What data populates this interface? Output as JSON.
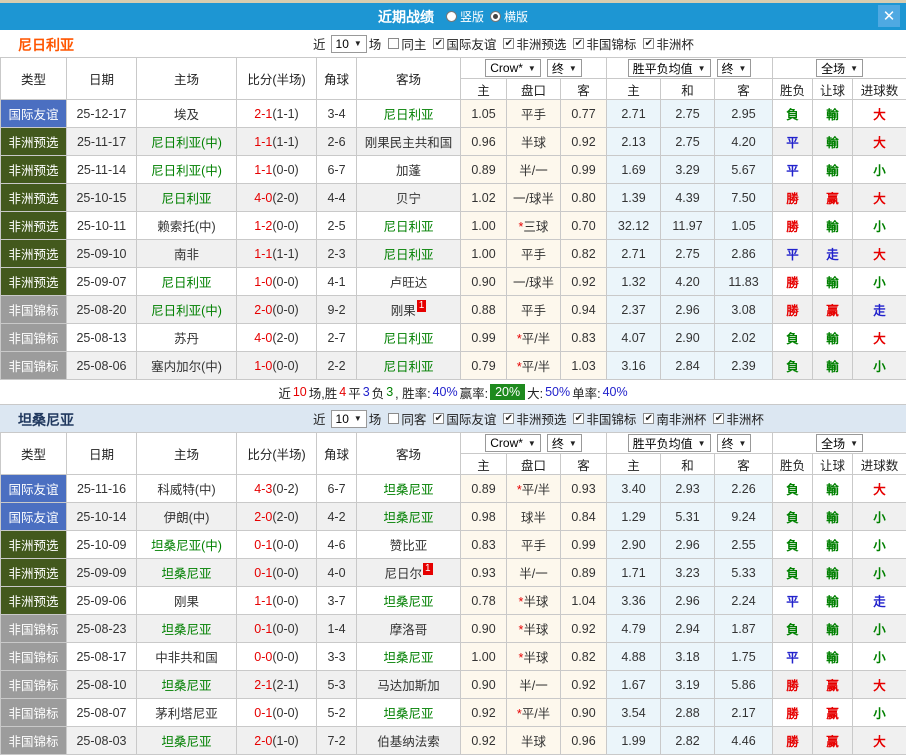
{
  "titlebar": {
    "title": "近期战绩",
    "radio_options": [
      {
        "label": "竖版",
        "selected": false
      },
      {
        "label": "横版",
        "selected": true
      }
    ],
    "close_label": "✕"
  },
  "table_header": {
    "type": "类型",
    "date": "日期",
    "home": "主场",
    "score": "比分(半场)",
    "corner": "角球",
    "away": "客场",
    "company_dd": "Crow*",
    "final_dd": "终",
    "avg_dd": "胜平负均值",
    "final_dd2": "终",
    "full_dd": "全场",
    "sub": {
      "odds_home": "主",
      "handicap": "盘口",
      "odds_away": "客",
      "avg_home": "主",
      "avg_draw": "和",
      "avg_away": "客",
      "result": "胜负",
      "handicap_result": "让球",
      "goals": "进球数"
    }
  },
  "colors": {
    "title_bar": "#1d96d3",
    "close_button": "#4fa9e2",
    "nigeria_text": "#ff5500",
    "nigeria_bar": "#ffffff",
    "tanzania_text": "#21395f",
    "tanzania_bar": "#dce7f2",
    "focal_team": "#008000",
    "win": "#e60000",
    "draw": "#2222cc",
    "lose": "#008000",
    "type_friendly": "#4b6fc1",
    "type_qualifier": "#43591d",
    "type_championship": "#9c9c9c",
    "red_card_badge": "#e60000",
    "summary_badge": "#1e8a1e"
  },
  "sections": [
    {
      "team": "尼日利亚",
      "team_color": "#ff5500",
      "bar_bg": "#ffffff",
      "filters": {
        "near_label": "近",
        "count": "10",
        "games_label": "场",
        "same_label": "同主",
        "same_checked": false,
        "leagues": [
          {
            "label": "国际友谊",
            "checked": true
          },
          {
            "label": "非洲预选",
            "checked": true
          },
          {
            "label": "非国锦标",
            "checked": true
          },
          {
            "label": "非洲杯",
            "checked": true
          }
        ]
      },
      "rows": [
        {
          "type": "国际友谊",
          "date": "25-12-17",
          "home": "埃及",
          "home_focal": false,
          "home_badge": "",
          "score_ft": "2-1",
          "score_ht": "(1-1)",
          "corners": "3-4",
          "away": "尼日利亚",
          "away_focal": true,
          "away_badge": "",
          "odds_home": "1.05",
          "handicap": "平手",
          "odds_away": "0.77",
          "avg_home": "2.71",
          "avg_draw": "2.75",
          "avg_away": "2.95",
          "result": "負",
          "handicap_result": "輸",
          "goals": "大"
        },
        {
          "type": "非洲预选",
          "date": "25-11-17",
          "home": "尼日利亚(中)",
          "home_focal": true,
          "home_badge": "",
          "score_ft": "1-1",
          "score_ht": "(1-1)",
          "corners": "2-6",
          "away": "刚果民主共和国",
          "away_focal": false,
          "away_badge": "",
          "odds_home": "0.96",
          "handicap": "半球",
          "odds_away": "0.92",
          "avg_home": "2.13",
          "avg_draw": "2.75",
          "avg_away": "4.20",
          "result": "平",
          "handicap_result": "輸",
          "goals": "大"
        },
        {
          "type": "非洲预选",
          "date": "25-11-14",
          "home": "尼日利亚(中)",
          "home_focal": true,
          "home_badge": "",
          "score_ft": "1-1",
          "score_ht": "(0-0)",
          "corners": "6-7",
          "away": "加蓬",
          "away_focal": false,
          "away_badge": "",
          "odds_home": "0.89",
          "handicap": "半/一",
          "odds_away": "0.99",
          "avg_home": "1.69",
          "avg_draw": "3.29",
          "avg_away": "5.67",
          "result": "平",
          "handicap_result": "輸",
          "goals": "小"
        },
        {
          "type": "非洲预选",
          "date": "25-10-15",
          "home": "尼日利亚",
          "home_focal": true,
          "home_badge": "",
          "score_ft": "4-0",
          "score_ht": "(2-0)",
          "corners": "4-4",
          "away": "贝宁",
          "away_focal": false,
          "away_badge": "",
          "odds_home": "1.02",
          "handicap": "一/球半",
          "odds_away": "0.80",
          "avg_home": "1.39",
          "avg_draw": "4.39",
          "avg_away": "7.50",
          "result": "勝",
          "handicap_result": "赢",
          "goals": "大"
        },
        {
          "type": "非洲预选",
          "date": "25-10-11",
          "home": "赖索托(中)",
          "home_focal": false,
          "home_badge": "",
          "score_ft": "1-2",
          "score_ht": "(0-0)",
          "corners": "2-5",
          "away": "尼日利亚",
          "away_focal": true,
          "away_badge": "",
          "odds_home": "1.00",
          "handicap": "*三球",
          "odds_away": "0.70",
          "avg_home": "32.12",
          "avg_draw": "11.97",
          "avg_away": "1.05",
          "result": "勝",
          "handicap_result": "輸",
          "goals": "小"
        },
        {
          "type": "非洲预选",
          "date": "25-09-10",
          "home": "南非",
          "home_focal": false,
          "home_badge": "",
          "score_ft": "1-1",
          "score_ht": "(1-1)",
          "corners": "2-3",
          "away": "尼日利亚",
          "away_focal": true,
          "away_badge": "",
          "odds_home": "1.00",
          "handicap": "平手",
          "odds_away": "0.82",
          "avg_home": "2.71",
          "avg_draw": "2.75",
          "avg_away": "2.86",
          "result": "平",
          "handicap_result": "走",
          "goals": "大"
        },
        {
          "type": "非洲预选",
          "date": "25-09-07",
          "home": "尼日利亚",
          "home_focal": true,
          "home_badge": "",
          "score_ft": "1-0",
          "score_ht": "(0-0)",
          "corners": "4-1",
          "away": "卢旺达",
          "away_focal": false,
          "away_badge": "",
          "odds_home": "0.90",
          "handicap": "一/球半",
          "odds_away": "0.92",
          "avg_home": "1.32",
          "avg_draw": "4.20",
          "avg_away": "11.83",
          "result": "勝",
          "handicap_result": "輸",
          "goals": "小"
        },
        {
          "type": "非国锦标",
          "date": "25-08-20",
          "home": "尼日利亚(中)",
          "home_focal": true,
          "home_badge": "",
          "score_ft": "2-0",
          "score_ht": "(0-0)",
          "corners": "9-2",
          "away": "刚果",
          "away_focal": false,
          "away_badge": "1",
          "odds_home": "0.88",
          "handicap": "平手",
          "odds_away": "0.94",
          "avg_home": "2.37",
          "avg_draw": "2.96",
          "avg_away": "3.08",
          "result": "勝",
          "handicap_result": "赢",
          "goals": "走"
        },
        {
          "type": "非国锦标",
          "date": "25-08-13",
          "home": "苏丹",
          "home_focal": false,
          "home_badge": "",
          "score_ft": "4-0",
          "score_ht": "(2-0)",
          "corners": "2-7",
          "away": "尼日利亚",
          "away_focal": true,
          "away_badge": "",
          "odds_home": "0.99",
          "handicap": "*平/半",
          "odds_away": "0.83",
          "avg_home": "4.07",
          "avg_draw": "2.90",
          "avg_away": "2.02",
          "result": "負",
          "handicap_result": "輸",
          "goals": "大"
        },
        {
          "type": "非国锦标",
          "date": "25-08-06",
          "home": "塞内加尔(中)",
          "home_focal": false,
          "home_badge": "",
          "score_ft": "1-0",
          "score_ht": "(0-0)",
          "corners": "2-2",
          "away": "尼日利亚",
          "away_focal": true,
          "away_badge": "",
          "odds_home": "0.79",
          "handicap": "*平/半",
          "odds_away": "1.03",
          "avg_home": "3.16",
          "avg_draw": "2.84",
          "avg_away": "2.39",
          "result": "負",
          "handicap_result": "輸",
          "goals": "小"
        }
      ],
      "summary": [
        {
          "t": "近",
          "c": "black"
        },
        {
          "t": "10",
          "c": "red"
        },
        {
          "t": "场,胜",
          "c": "black"
        },
        {
          "t": "4",
          "c": "red"
        },
        {
          "t": "平",
          "c": "black"
        },
        {
          "t": "3",
          "c": "blue"
        },
        {
          "t": "负",
          "c": "black"
        },
        {
          "t": "3",
          "c": "green"
        },
        {
          "t": ", 胜率:",
          "c": "black"
        },
        {
          "t": "40%",
          "c": "blue"
        },
        {
          "t": " 赢率:",
          "c": "black"
        },
        {
          "t": "20%",
          "c": "badge"
        },
        {
          "t": " 大:",
          "c": "black"
        },
        {
          "t": "50%",
          "c": "blue"
        },
        {
          "t": " 单率:",
          "c": "black"
        },
        {
          "t": "40%",
          "c": "blue"
        }
      ]
    },
    {
      "team": "坦桑尼亚",
      "team_color": "#21395f",
      "bar_bg": "#dce7f2",
      "filters": {
        "near_label": "近",
        "count": "10",
        "games_label": "场",
        "same_label": "同客",
        "same_checked": false,
        "leagues": [
          {
            "label": "国际友谊",
            "checked": true
          },
          {
            "label": "非洲预选",
            "checked": true
          },
          {
            "label": "非国锦标",
            "checked": true
          },
          {
            "label": "南非洲杯",
            "checked": true
          },
          {
            "label": "非洲杯",
            "checked": true
          }
        ]
      },
      "rows": [
        {
          "type": "国际友谊",
          "date": "25-11-16",
          "home": "科威特(中)",
          "home_focal": false,
          "home_badge": "",
          "score_ft": "4-3",
          "score_ht": "(0-2)",
          "corners": "6-7",
          "away": "坦桑尼亚",
          "away_focal": true,
          "away_badge": "",
          "odds_home": "0.89",
          "handicap": "*平/半",
          "odds_away": "0.93",
          "avg_home": "3.40",
          "avg_draw": "2.93",
          "avg_away": "2.26",
          "result": "負",
          "handicap_result": "輸",
          "goals": "大"
        },
        {
          "type": "国际友谊",
          "date": "25-10-14",
          "home": "伊朗(中)",
          "home_focal": false,
          "home_badge": "",
          "score_ft": "2-0",
          "score_ht": "(2-0)",
          "corners": "4-2",
          "away": "坦桑尼亚",
          "away_focal": true,
          "away_badge": "",
          "odds_home": "0.98",
          "handicap": "球半",
          "odds_away": "0.84",
          "avg_home": "1.29",
          "avg_draw": "5.31",
          "avg_away": "9.24",
          "result": "負",
          "handicap_result": "輸",
          "goals": "小"
        },
        {
          "type": "非洲预选",
          "date": "25-10-09",
          "home": "坦桑尼亚(中)",
          "home_focal": true,
          "home_badge": "",
          "score_ft": "0-1",
          "score_ht": "(0-0)",
          "corners": "4-6",
          "away": "赞比亚",
          "away_focal": false,
          "away_badge": "",
          "odds_home": "0.83",
          "handicap": "平手",
          "odds_away": "0.99",
          "avg_home": "2.90",
          "avg_draw": "2.96",
          "avg_away": "2.55",
          "result": "負",
          "handicap_result": "輸",
          "goals": "小"
        },
        {
          "type": "非洲预选",
          "date": "25-09-09",
          "home": "坦桑尼亚",
          "home_focal": true,
          "home_badge": "",
          "score_ft": "0-1",
          "score_ht": "(0-0)",
          "corners": "4-0",
          "away": "尼日尔",
          "away_focal": false,
          "away_badge": "1",
          "odds_home": "0.93",
          "handicap": "半/一",
          "odds_away": "0.89",
          "avg_home": "1.71",
          "avg_draw": "3.23",
          "avg_away": "5.33",
          "result": "負",
          "handicap_result": "輸",
          "goals": "小"
        },
        {
          "type": "非洲预选",
          "date": "25-09-06",
          "home": "刚果",
          "home_focal": false,
          "home_badge": "",
          "score_ft": "1-1",
          "score_ht": "(0-0)",
          "corners": "3-7",
          "away": "坦桑尼亚",
          "away_focal": true,
          "away_badge": "",
          "odds_home": "0.78",
          "handicap": "*半球",
          "odds_away": "1.04",
          "avg_home": "3.36",
          "avg_draw": "2.96",
          "avg_away": "2.24",
          "result": "平",
          "handicap_result": "輸",
          "goals": "走"
        },
        {
          "type": "非国锦标",
          "date": "25-08-23",
          "home": "坦桑尼亚",
          "home_focal": true,
          "home_badge": "",
          "score_ft": "0-1",
          "score_ht": "(0-0)",
          "corners": "1-4",
          "away": "摩洛哥",
          "away_focal": false,
          "away_badge": "",
          "odds_home": "0.90",
          "handicap": "*半球",
          "odds_away": "0.92",
          "avg_home": "4.79",
          "avg_draw": "2.94",
          "avg_away": "1.87",
          "result": "負",
          "handicap_result": "輸",
          "goals": "小"
        },
        {
          "type": "非国锦标",
          "date": "25-08-17",
          "home": "中非共和国",
          "home_focal": false,
          "home_badge": "",
          "score_ft": "0-0",
          "score_ht": "(0-0)",
          "corners": "3-3",
          "away": "坦桑尼亚",
          "away_focal": true,
          "away_badge": "",
          "odds_home": "1.00",
          "handicap": "*半球",
          "odds_away": "0.82",
          "avg_home": "4.88",
          "avg_draw": "3.18",
          "avg_away": "1.75",
          "result": "平",
          "handicap_result": "輸",
          "goals": "小"
        },
        {
          "type": "非国锦标",
          "date": "25-08-10",
          "home": "坦桑尼亚",
          "home_focal": true,
          "home_badge": "",
          "score_ft": "2-1",
          "score_ht": "(2-1)",
          "corners": "5-3",
          "away": "马达加斯加",
          "away_focal": false,
          "away_badge": "",
          "odds_home": "0.90",
          "handicap": "半/一",
          "odds_away": "0.92",
          "avg_home": "1.67",
          "avg_draw": "3.19",
          "avg_away": "5.86",
          "result": "勝",
          "handicap_result": "赢",
          "goals": "大"
        },
        {
          "type": "非国锦标",
          "date": "25-08-07",
          "home": "茅利塔尼亚",
          "home_focal": false,
          "home_badge": "",
          "score_ft": "0-1",
          "score_ht": "(0-0)",
          "corners": "5-2",
          "away": "坦桑尼亚",
          "away_focal": true,
          "away_badge": "",
          "odds_home": "0.92",
          "handicap": "*平/半",
          "odds_away": "0.90",
          "avg_home": "3.54",
          "avg_draw": "2.88",
          "avg_away": "2.17",
          "result": "勝",
          "handicap_result": "赢",
          "goals": "小"
        },
        {
          "type": "非国锦标",
          "date": "25-08-03",
          "home": "坦桑尼亚",
          "home_focal": true,
          "home_badge": "",
          "score_ft": "2-0",
          "score_ht": "(1-0)",
          "corners": "7-2",
          "away": "伯基纳法索",
          "away_focal": false,
          "away_badge": "",
          "odds_home": "0.92",
          "handicap": "半球",
          "odds_away": "0.96",
          "avg_home": "1.99",
          "avg_draw": "2.82",
          "avg_away": "4.46",
          "result": "勝",
          "handicap_result": "赢",
          "goals": "大"
        }
      ],
      "summary": null
    }
  ]
}
